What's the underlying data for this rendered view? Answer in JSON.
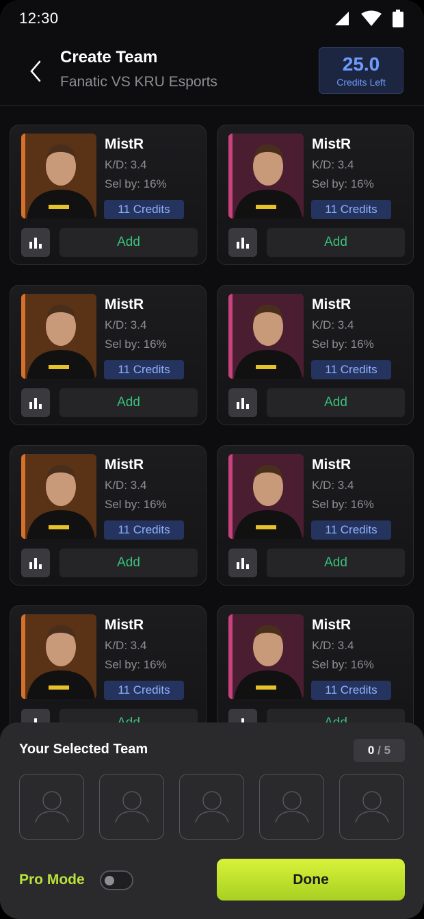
{
  "status_bar": {
    "time": "12:30"
  },
  "header": {
    "title": "Create Team",
    "subtitle": "Fanatic VS KRU Esports",
    "credits_value": "25.0",
    "credits_label": "Credits Left"
  },
  "players": [
    {
      "name": "MistR",
      "kd": "K/D: 3.4",
      "sel": "Sel by: 16%",
      "credits": "11 Credits",
      "add": "Add",
      "team_color": "#d6702c"
    },
    {
      "name": "MistR",
      "kd": "K/D: 3.4",
      "sel": "Sel by: 16%",
      "credits": "11 Credits",
      "add": "Add",
      "team_color": "#c8427d"
    },
    {
      "name": "MistR",
      "kd": "K/D: 3.4",
      "sel": "Sel by: 16%",
      "credits": "11 Credits",
      "add": "Add",
      "team_color": "#d6702c"
    },
    {
      "name": "MistR",
      "kd": "K/D: 3.4",
      "sel": "Sel by: 16%",
      "credits": "11 Credits",
      "add": "Add",
      "team_color": "#c8427d"
    },
    {
      "name": "MistR",
      "kd": "K/D: 3.4",
      "sel": "Sel by: 16%",
      "credits": "11 Credits",
      "add": "Add",
      "team_color": "#d6702c"
    },
    {
      "name": "MistR",
      "kd": "K/D: 3.4",
      "sel": "Sel by: 16%",
      "credits": "11 Credits",
      "add": "Add",
      "team_color": "#c8427d"
    },
    {
      "name": "MistR",
      "kd": "K/D: 3.4",
      "sel": "Sel by: 16%",
      "credits": "11 Credits",
      "add": "Add",
      "team_color": "#d6702c"
    },
    {
      "name": "MistR",
      "kd": "K/D: 3.4",
      "sel": "Sel by: 16%",
      "credits": "11 Credits",
      "add": "Add",
      "team_color": "#c8427d"
    }
  ],
  "selected_team": {
    "title": "Your Selected Team",
    "count": "0",
    "separator": "/",
    "total": "5"
  },
  "footer": {
    "pro_mode_label": "Pro Mode",
    "pro_mode_on": false,
    "done_label": "Done"
  },
  "colors": {
    "accent_green": "#36c27a",
    "accent_lime": "#b8e23a",
    "accent_blue": "#6f9bff"
  }
}
